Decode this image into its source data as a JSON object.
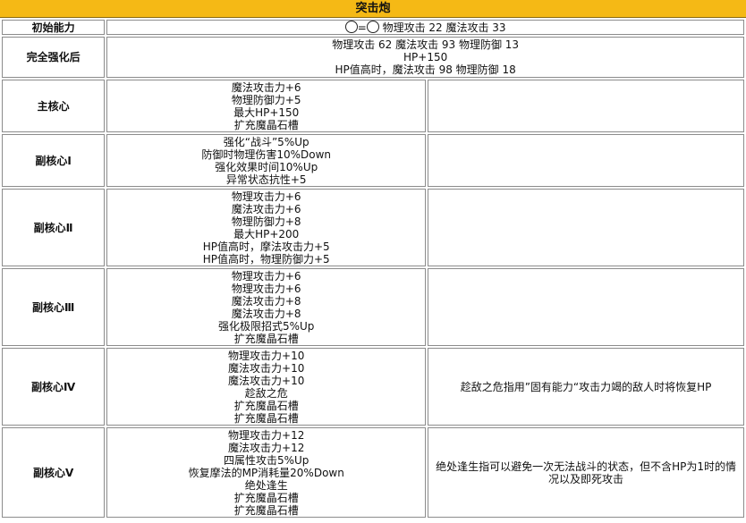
{
  "title": "突击炮",
  "initial": {
    "label": "初始能力",
    "eq": "=",
    "text": "物理攻击 22 魔法攻击 33"
  },
  "full": {
    "label": "完全强化后",
    "lines": [
      "物理攻击 62 魔法攻击 93 物理防御 13",
      "HP+150",
      "HP值高时，魔法攻击 98 物理防御 18"
    ]
  },
  "rows": [
    {
      "label": "主核心",
      "lines": [
        "魔法攻击力+6",
        "物理防御力+5",
        "最大HP+150",
        "扩充魔晶石槽"
      ],
      "note": ""
    },
    {
      "label": "副核心Ⅰ",
      "lines": [
        "强化“战斗”5%Up",
        "防御时物理伤害10%Down",
        "强化效果时间10%Up",
        "异常状态抗性+5"
      ],
      "note": ""
    },
    {
      "label": "副核心Ⅱ",
      "lines": [
        "物理攻击力+6",
        "魔法攻击力+6",
        "物理防御力+8",
        "最大HP+200",
        "HP值高时，摩法攻击力+5",
        "HP值高时，物理防御力+5"
      ],
      "note": ""
    },
    {
      "label": "副核心Ⅲ",
      "lines": [
        "物理攻击力+6",
        "物理攻击力+6",
        "魔法攻击力+8",
        "魔法攻击力+8",
        "强化极限招式5%Up",
        "扩充魔晶石槽"
      ],
      "note": ""
    },
    {
      "label": "副核心Ⅳ",
      "lines": [
        "物理攻击力+10",
        "魔法攻击力+10",
        "魔法攻击力+10",
        "趁敌之危",
        "扩充魔晶石槽",
        "扩充魔晶石槽"
      ],
      "note": "趁敌之危指用”固有能力“攻击力竭的敌人时将恢复HP"
    },
    {
      "label": "副核心Ⅴ",
      "lines": [
        "物理攻击力+12",
        "魔法攻击力+12",
        "四属性攻击5%Up",
        "恢复摩法的MP消耗量20%Down",
        "绝处逢生",
        "扩充魔晶石槽",
        "扩充魔晶石槽"
      ],
      "note": "绝处逢生指可以避免一次无法战斗的状态，但不含HP为1时的情况以及即死攻击"
    }
  ]
}
